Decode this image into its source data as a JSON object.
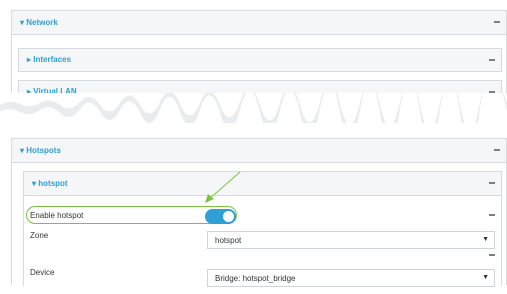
{
  "network": {
    "title": "Network",
    "toggle_icon": "collapse-dash"
  },
  "interfaces": {
    "title": "Interfaces",
    "toggle_icon": "collapse-dash"
  },
  "virtual_lan": {
    "title": "Virtual LAN",
    "toggle_icon": "collapse-dash"
  },
  "hotspots": {
    "title": "Hotspots",
    "toggle_icon": "collapse-dash"
  },
  "hotspot": {
    "title": "hotspot",
    "enable_label": "Enable hotspot",
    "enable_value": true,
    "zone_label": "Zone",
    "zone_value": "hotspot",
    "device_label": "Device",
    "device_value": "Bridge: hotspot_bridge"
  },
  "colors": {
    "accent": "#2f9fd4",
    "highlight": "#7dc242"
  }
}
